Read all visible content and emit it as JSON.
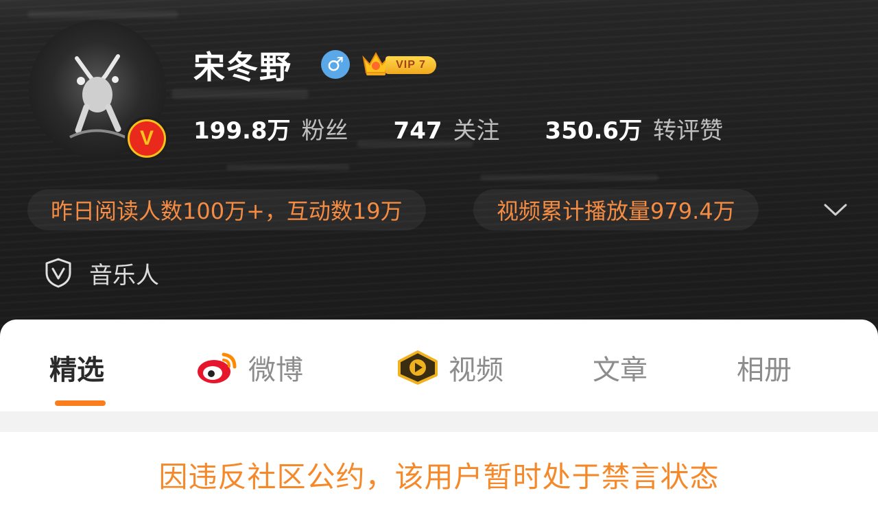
{
  "profile": {
    "name": "宋冬野",
    "gender_symbol": "♂",
    "vip_label": "VIP 7",
    "verified_symbol": "V"
  },
  "stats": [
    {
      "value": "199.8万",
      "label": "粉丝"
    },
    {
      "value": "747",
      "label": "关注"
    },
    {
      "value": "350.6万",
      "label": "转评赞"
    }
  ],
  "highlights": {
    "reading": "昨日阅读人数100万+，互动数19万",
    "video_plays": "视频累计播放量979.4万"
  },
  "role": {
    "label": "音乐人"
  },
  "tabs": [
    {
      "label": "精选",
      "icon": "none",
      "active": true
    },
    {
      "label": "微博",
      "icon": "weibo-icon",
      "active": false
    },
    {
      "label": "视频",
      "icon": "video-play-icon",
      "active": false
    },
    {
      "label": "文章",
      "icon": "none",
      "active": false
    },
    {
      "label": "相册",
      "icon": "none",
      "active": false
    }
  ],
  "notice": "因违反社区公约，该用户暂时处于禁言状态",
  "colors": {
    "accent_orange": "#f58c44",
    "tab_underline": "#fa7d1e",
    "badge_red": "#e8291c",
    "badge_gold": "#f7c21a",
    "gender_blue": "#5aa8e8"
  }
}
